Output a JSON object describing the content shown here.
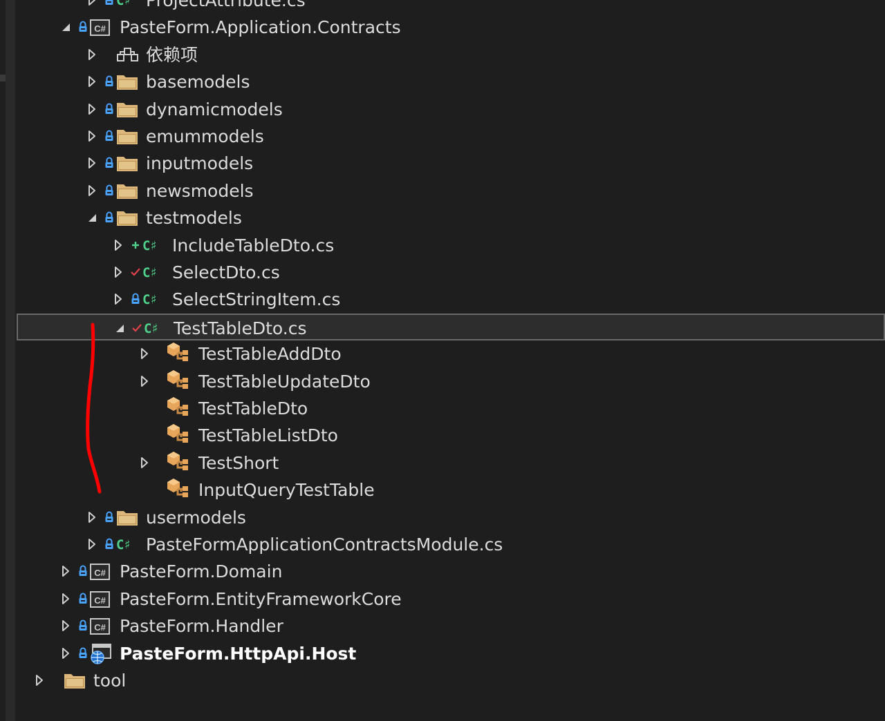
{
  "theme": {
    "background": "#1e1e1e",
    "selection": "#2d2d2d",
    "text": "#dcdcdc",
    "folder": "#dcb67a",
    "lock": "#4aa3ff",
    "csharp": "#4fd18b",
    "annotation": "#ff0000"
  },
  "tree": {
    "items": [
      {
        "label": "ProjectAttribute.cs",
        "expander": "collapsed",
        "state": "lock",
        "icon": "csharp-file-icon"
      },
      {
        "label": "PasteForm.Application.Contracts",
        "expander": "expanded",
        "state": "lock",
        "icon": "csharp-project-icon"
      },
      {
        "label": "依赖项",
        "expander": "collapsed",
        "state": "",
        "icon": "dependencies-icon"
      },
      {
        "label": "basemodels",
        "expander": "collapsed",
        "state": "lock",
        "icon": "folder-icon"
      },
      {
        "label": "dynamicmodels",
        "expander": "collapsed",
        "state": "lock",
        "icon": "folder-icon"
      },
      {
        "label": "emummodels",
        "expander": "collapsed",
        "state": "lock",
        "icon": "folder-icon"
      },
      {
        "label": "inputmodels",
        "expander": "collapsed",
        "state": "lock",
        "icon": "folder-icon"
      },
      {
        "label": "newsmodels",
        "expander": "collapsed",
        "state": "lock",
        "icon": "folder-icon"
      },
      {
        "label": "testmodels",
        "expander": "expanded",
        "state": "lock",
        "icon": "folder-icon"
      },
      {
        "label": "IncludeTableDto.cs",
        "expander": "collapsed",
        "state": "added",
        "icon": "csharp-file-icon"
      },
      {
        "label": "SelectDto.cs",
        "expander": "collapsed",
        "state": "checked-out",
        "icon": "csharp-file-icon"
      },
      {
        "label": "SelectStringItem.cs",
        "expander": "collapsed",
        "state": "lock",
        "icon": "csharp-file-icon"
      },
      {
        "label": "TestTableDto.cs",
        "expander": "expanded",
        "state": "checked-out",
        "icon": "csharp-file-icon",
        "selected": true
      },
      {
        "label": "TestTableAddDto",
        "expander": "collapsed",
        "state": "",
        "icon": "class-icon"
      },
      {
        "label": "TestTableUpdateDto",
        "expander": "collapsed",
        "state": "",
        "icon": "class-icon"
      },
      {
        "label": "TestTableDto",
        "expander": "none",
        "state": "",
        "icon": "class-icon"
      },
      {
        "label": "TestTableListDto",
        "expander": "none",
        "state": "",
        "icon": "class-icon"
      },
      {
        "label": "TestShort",
        "expander": "collapsed",
        "state": "",
        "icon": "class-icon"
      },
      {
        "label": "InputQueryTestTable",
        "expander": "none",
        "state": "",
        "icon": "class-icon"
      },
      {
        "label": "usermodels",
        "expander": "collapsed",
        "state": "lock",
        "icon": "folder-icon"
      },
      {
        "label": "PasteFormApplicationContractsModule.cs",
        "expander": "collapsed",
        "state": "lock",
        "icon": "csharp-file-icon"
      },
      {
        "label": "PasteForm.Domain",
        "expander": "collapsed",
        "state": "lock",
        "icon": "csharp-project-icon"
      },
      {
        "label": "PasteForm.EntityFrameworkCore",
        "expander": "collapsed",
        "state": "lock",
        "icon": "csharp-project-icon"
      },
      {
        "label": "PasteForm.Handler",
        "expander": "collapsed",
        "state": "lock",
        "icon": "csharp-project-icon"
      },
      {
        "label": "PasteForm.HttpApi.Host",
        "expander": "collapsed",
        "state": "lock",
        "icon": "web-project-icon",
        "bold": true
      },
      {
        "label": "tool",
        "expander": "collapsed",
        "state": "",
        "icon": "folder-icon"
      }
    ]
  }
}
